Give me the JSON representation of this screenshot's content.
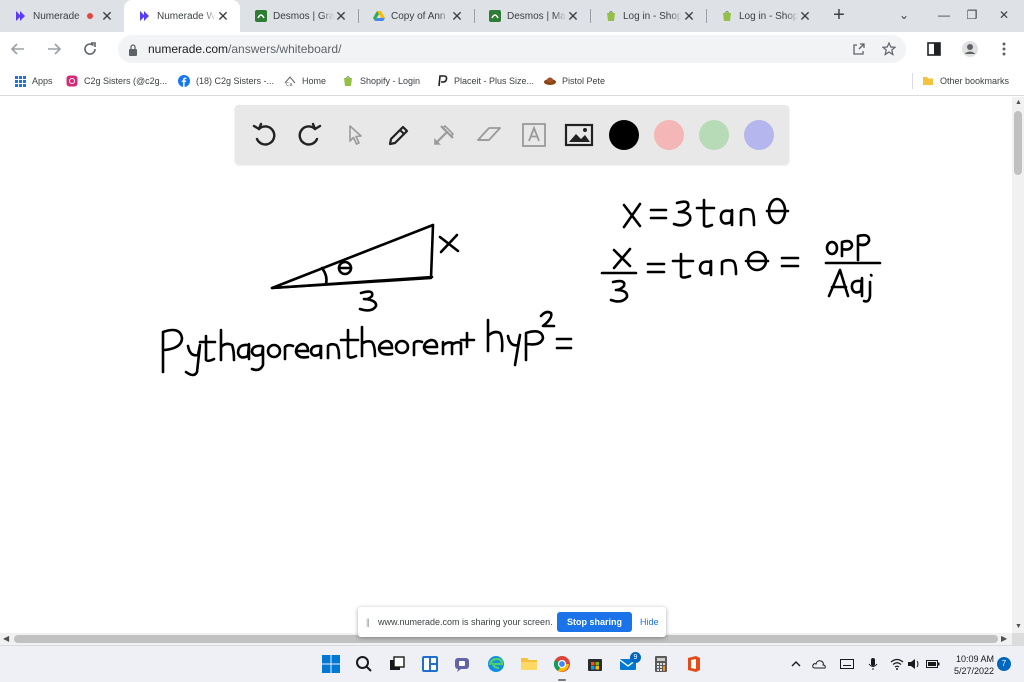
{
  "tabs": [
    {
      "title": "Numerade",
      "icon": "numerade-icon",
      "recording": true
    },
    {
      "title": "Numerade Wh",
      "icon": "numerade-icon",
      "active": true
    },
    {
      "title": "Desmos | Grap",
      "icon": "desmos-icon"
    },
    {
      "title": "Copy of Ann X",
      "icon": "google-drive-icon"
    },
    {
      "title": "Desmos | Matr",
      "icon": "desmos-icon"
    },
    {
      "title": "Log in - Shopif",
      "icon": "shopify-icon"
    },
    {
      "title": "Log in - Shopif",
      "icon": "shopify-icon"
    }
  ],
  "address_bar": {
    "domain": "numerade.com",
    "path": "/answers/whiteboard/"
  },
  "bookmarks": [
    {
      "label": "Apps",
      "icon": "apps-grid-icon"
    },
    {
      "label": "C2g Sisters (@c2g...",
      "icon": "instagram-icon"
    },
    {
      "label": "(18) C2g Sisters -...",
      "icon": "facebook-icon"
    },
    {
      "label": "Home",
      "icon": "home-bookmark-icon"
    },
    {
      "label": "Shopify - Login",
      "icon": "shopify-icon"
    },
    {
      "label": "Placeit - Plus Size...",
      "icon": "placeit-icon"
    },
    {
      "label": "Pistol Pete",
      "icon": "pistol-pete-icon"
    }
  ],
  "other_bookmarks": "Other bookmarks",
  "whiteboard": {
    "tools": [
      "undo-icon",
      "redo-icon",
      "pointer-icon",
      "pen-icon",
      "tools-icon",
      "eraser-icon",
      "text-icon",
      "image-icon"
    ],
    "colors": [
      "#000000",
      "#f4b6b6",
      "#b6dbb6",
      "#b6b6ee"
    ],
    "handwriting": {
      "line1": "X = 3 tan θ",
      "line2_left": "x / 3 = tan θ =",
      "ratio": "Opp / Adj",
      "triangle_side_x": "x",
      "triangle_side_3": "3",
      "triangle_angle": "θ",
      "line3": "Pythagorean theorem : hyp² ="
    }
  },
  "share_banner": {
    "message": "www.numerade.com is sharing your screen.",
    "stop_label": "Stop sharing",
    "hide_label": "Hide"
  },
  "taskbar": {
    "time": "10:09 AM",
    "date": "5/27/2022",
    "notifications": "7",
    "mail_badge": "9"
  }
}
